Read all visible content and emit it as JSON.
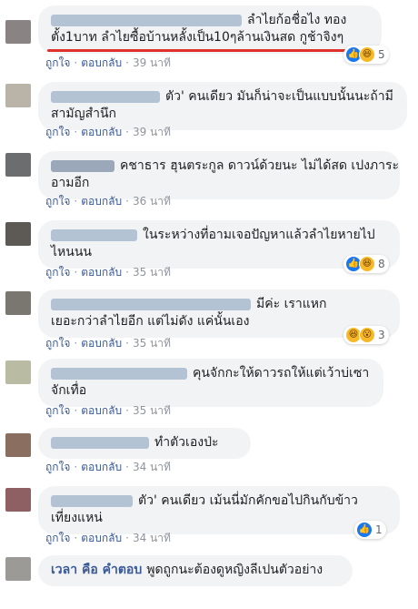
{
  "actions": {
    "like": "ถูกใจ",
    "reply": "ตอบกลับ"
  },
  "comments": [
    {
      "line1": "ลำไยก้อชื่อไง ทอง",
      "line2": "ตั้ง1บาท ลำไยซื้อบ้านหลั้งเป็น10ๆล้านเงินสด กูช้าจิงๆ",
      "time": "39 นาที",
      "reactions": {
        "icons": [
          "like-icon",
          "haha-icon"
        ],
        "count": "5"
      }
    },
    {
      "line1": "ตัว' คนเดียว มันก็น่าจะเป็นแบบนั้นนะถ้ามี",
      "line2": "สามัญสำนึก",
      "time": "39 นาที"
    },
    {
      "line1": "คชาธาร ฮุนตระกูล ดาวน์ด้วยนะ ไม่ได้สด เปงภาระ",
      "line2": "อามอีก",
      "time": "36 นาที"
    },
    {
      "line1": "ในระหว่างที่อามเจอปัญหาแล้วลำไยหายไป",
      "line2": "ไหนนน",
      "time": "35 นาที",
      "reactions": {
        "icons": [
          "like-icon",
          "haha-icon"
        ],
        "count": "8"
      }
    },
    {
      "line1": "มีค่ะ เราแหก",
      "line2": "เยอะกว่าลำไยอีก แต่ไม่ดัง แค่นั้นเอง",
      "time": "35 นาที",
      "reactions": {
        "icons": [
          "haha-icon",
          "wow-icon"
        ],
        "count": "3"
      }
    },
    {
      "line1": "คุนจักกะให้ดาวรถให้แต่เว้าบ่เซา",
      "line2": "จักเทื่อ",
      "time": "35 นาที"
    },
    {
      "line1": "ทำตัวเองป่ะ",
      "time": "34 นาที"
    },
    {
      "line1": "ตัว' คนเดียว เม้นนี่มักคักขอไปกินกับข้าว",
      "line2": "เที่ยงแหน่",
      "time": "34 นาที",
      "reactions": {
        "icons": [
          "like-icon"
        ],
        "count": "1"
      }
    },
    {
      "name": "เวลา คือ คำตอบ",
      "line1": "พูดถูกนะต้องดูหญิงลีเปนตัวอย่าง"
    }
  ]
}
